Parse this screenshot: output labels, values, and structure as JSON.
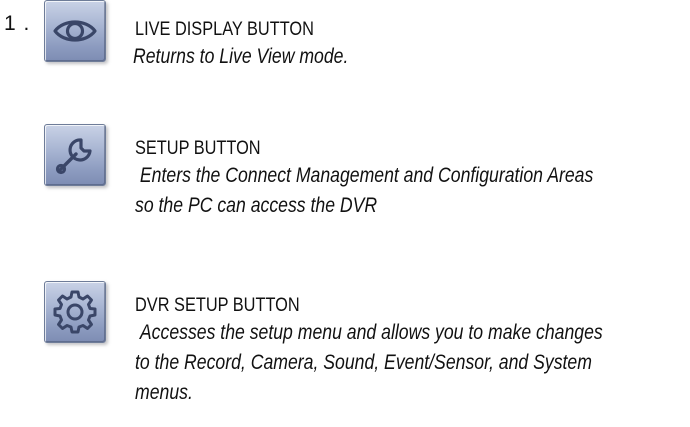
{
  "items": [
    {
      "number": "1 .",
      "icon": "eye-icon",
      "title": "LIVE DISPLAY BUTTON",
      "description": "Returns to Live View mode."
    },
    {
      "icon": "wrench-icon",
      "title": "SETUP BUTTON",
      "description": " Enters the Connect Management and Configuration Areas\nso the PC can access the DVR"
    },
    {
      "icon": "gear-icon",
      "title": "DVR SETUP BUTTON",
      "description": " Accesses the setup menu and allows you to make changes\nto the Record, Camera, Sound, Event/Sensor, and System\nmenus."
    }
  ],
  "colors": {
    "button_light": "#c9d2e6",
    "button_dark": "#7d8cb3",
    "icon_stroke": "#3a4668",
    "text": "#111111"
  }
}
